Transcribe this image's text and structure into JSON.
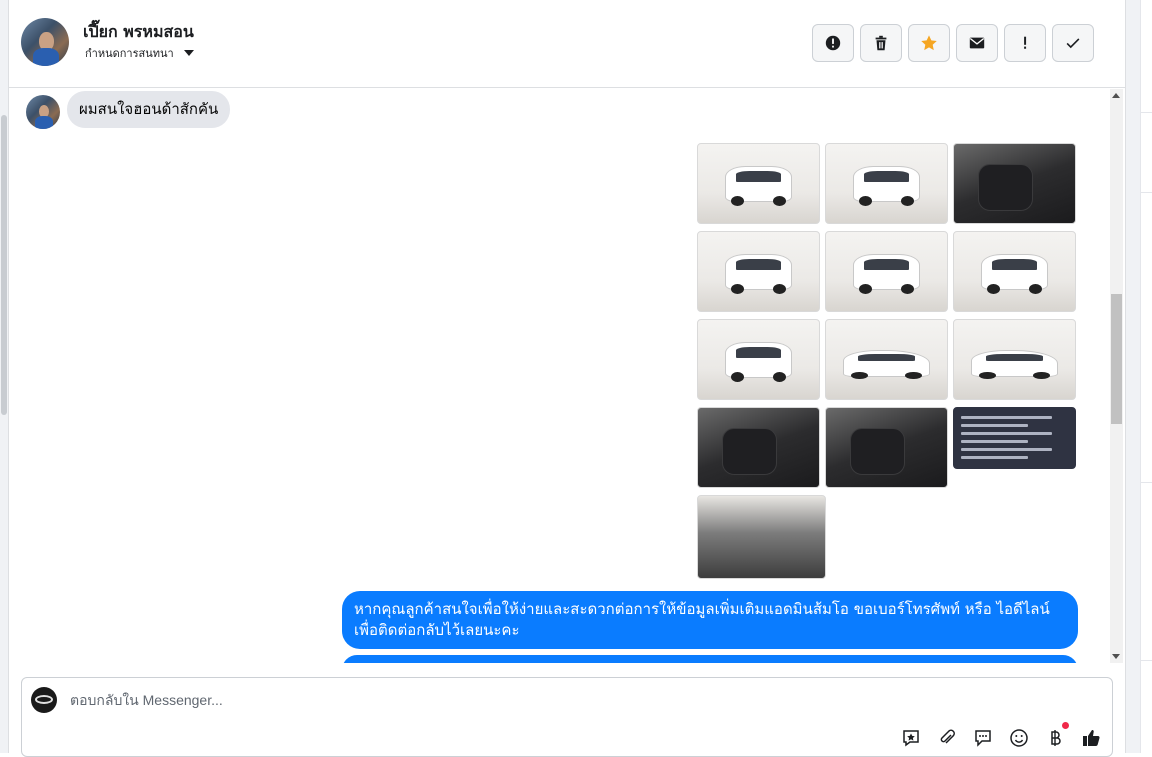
{
  "header": {
    "contact_name": "เปี๊ยก พรหมสอน",
    "assign_label": "กำหนดการสนทนา",
    "toolbar": [
      {
        "name": "report-spam-button",
        "icon": "exclamation-circle-icon"
      },
      {
        "name": "delete-button",
        "icon": "trash-icon"
      },
      {
        "name": "star-button",
        "icon": "star-icon",
        "color": "#f5a623"
      },
      {
        "name": "mark-unread-button",
        "icon": "envelope-icon"
      },
      {
        "name": "follow-up-button",
        "icon": "exclamation-icon"
      },
      {
        "name": "mark-done-button",
        "icon": "check-icon"
      }
    ]
  },
  "messages": {
    "incoming_text": "ผมสนใจฮอนด้าสักคัน",
    "photo_album": [
      {
        "kind": "car-front",
        "icon": "car-photo"
      },
      {
        "kind": "car-front",
        "icon": "car-photo"
      },
      {
        "kind": "interior",
        "icon": "interior-photo"
      },
      {
        "kind": "car-rear",
        "icon": "car-photo"
      },
      {
        "kind": "car-front",
        "icon": "car-photo"
      },
      {
        "kind": "car-rear",
        "icon": "car-photo"
      },
      {
        "kind": "car-rear",
        "icon": "car-photo"
      },
      {
        "kind": "car-side",
        "icon": "car-photo"
      },
      {
        "kind": "car-side",
        "icon": "car-photo"
      },
      {
        "kind": "interior",
        "icon": "interior-photo"
      },
      {
        "kind": "interior",
        "icon": "interior-photo"
      },
      {
        "kind": "document",
        "icon": "document-photo"
      },
      {
        "kind": "engine",
        "icon": "engine-photo"
      }
    ],
    "outgoing_text": "หากคุณลูกค้าสนใจเพื่อให้ง่ายและสะดวกต่อการให้ข้อมูลเพิ่มเติมแอดมินส้มโอ ขอเบอร์โทรศัพท์ หรือ ไอดีไลน์ เพื่อติดต่อกลับไว้เลยนะคะ",
    "outgoing_color": "#0a7cff"
  },
  "composer": {
    "placeholder": "ตอบกลับใน Messenger...",
    "tools": [
      "saved-reply-icon",
      "attachment-icon",
      "chat-bubble-icon",
      "emoji-icon",
      "baht-payment-icon",
      "like-icon"
    ]
  },
  "colors": {
    "accent": "#0a7cff",
    "star": "#f5a623",
    "notification": "#f02849"
  }
}
